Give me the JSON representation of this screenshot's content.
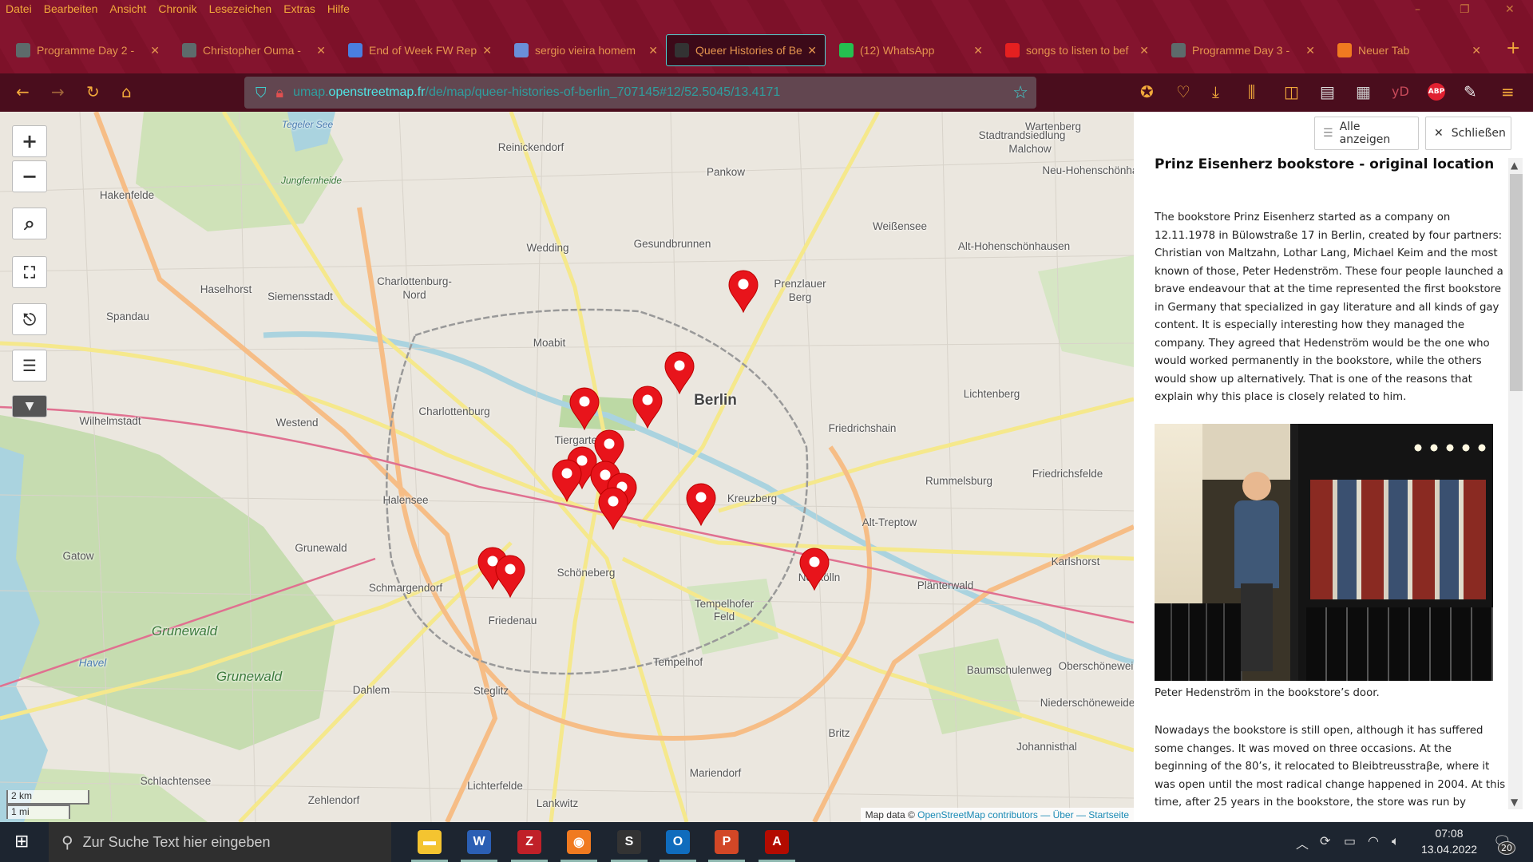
{
  "menu": [
    "Datei",
    "Bearbeiten",
    "Ansicht",
    "Chronik",
    "Lesezeichen",
    "Extras",
    "Hilfe"
  ],
  "window_controls": {
    "minimize": "–",
    "restore": "❐",
    "close": "✕"
  },
  "tabs": [
    {
      "title": "Programme Day 2 -",
      "icon": "x-logo-icon",
      "color": "#5d6b6b"
    },
    {
      "title": "Christopher Ouma -",
      "icon": "x-logo-icon",
      "color": "#5d6b6b"
    },
    {
      "title": "End of Week FW Rep",
      "icon": "google-docs-icon",
      "color": "#4a7fe0"
    },
    {
      "title": "sergio vieira homem",
      "icon": "diamond-icon",
      "color": "#6a8fd8"
    },
    {
      "title": "Queer Histories of Be",
      "icon": "umap-icon",
      "color": "#333",
      "active": true
    },
    {
      "title": "(12) WhatsApp",
      "icon": "whatsapp-icon",
      "color": "#25c050"
    },
    {
      "title": "songs to listen to bef",
      "icon": "youtube-icon",
      "color": "#e52020"
    },
    {
      "title": "Programme Day 3 -",
      "icon": "x-logo-icon",
      "color": "#5d6b6b"
    },
    {
      "title": "Neuer Tab",
      "icon": "firefox-icon",
      "color": "#f07a20"
    }
  ],
  "new_tab": "+",
  "url": {
    "sub": "umap.",
    "domain": "openstreetmap.fr",
    "path": "/de/map/queer-histories-of-berlin_707145#12/52.5045/13.4171"
  },
  "map": {
    "controls": {
      "zoom_in": "+",
      "zoom_out": "−"
    },
    "labels": [
      "Reinickendorf",
      "Wartenberg",
      "Stadtrandsiedlung",
      "Malchow",
      "Pankow",
      "Neu-Hohenschönhausen",
      "Hakenfelde",
      "Weißensee",
      "Gesundbrunnen",
      "Wedding",
      "Alt-Hohenschönhausen",
      "Haselhorst",
      "Siemensstadt",
      "Charlottenburg-",
      "Nord",
      "Spandau",
      "Prenzlauer",
      "Berg",
      "Moabit",
      "Berlin",
      "Lichtenberg",
      "Wilhelmstadt",
      "Westend",
      "Charlottenburg",
      "Tiergarten",
      "Friedrichshain",
      "Rummelsburg",
      "Friedrichsfelde",
      "Halensee",
      "Kreuzberg",
      "Alt-Treptow",
      "Grunewald",
      "Gatow",
      "Karlshorst",
      "Schmargendorf",
      "Schöneberg",
      "Neukölln",
      "Plänterwald",
      "Friedenau",
      "Tempelhofer",
      "Feld",
      "Grunewald",
      "Grunewald",
      "Tempelhof",
      "Baumschulenweg",
      "Oberschöneweide",
      "Dahlem",
      "Steglitz",
      "Niederschöneweide",
      "Britz",
      "Johannisthal",
      "Mariendorf",
      "Schlachtensee",
      "Lichterfelde",
      "Zehlendorf",
      "Lankwitz",
      "Havel",
      "Jungfernheide",
      "Tegeler See"
    ],
    "marker_count": 14,
    "scale": {
      "km": "2 km",
      "mi": "1 mi"
    },
    "attribution": {
      "prefix": "Map data ©",
      "osm": "OpenStreetMap contributors",
      "sep1": "—",
      "about": "Über",
      "sep2": "—",
      "home": "Startseite"
    }
  },
  "panel": {
    "show_all": "Alle anzeigen",
    "close": "Schließen",
    "title": "Prinz Eisenherz bookstore - original location",
    "para1": "The bookstore Prinz Eisenherz started as a company on 12.11.1978 in Bülowstraße 17 in Berlin, created by four partners: Christian von Maltzahn, Lothar Lang, Michael Keim and the most known of those, Peter Hedenström. These four people launched a brave endeavour that at the time represented the first bookstore in Germany that specialized in gay literature and all kinds of gay content. It is especially interesting how they managed the company. They agreed that Hedenström would be the one who would worked permanently in the bookstore, while the others would show up alternatively. That is one of the reasons that explain why this place is closely related to him.",
    "caption": "Peter Hedenström in the bookstore’s door.",
    "para2": "Nowadays the bookstore is still open, although it has suffered some changes. It was moved on three occasions. At the beginning of the 80’s, it relocated to Bleibtreusstraβe, where it was open until the most radical change happened in 2004. At this time, after 25 years in the bookstore, the store was run by"
  },
  "taskbar": {
    "search_placeholder": "Zur Suche Text hier eingeben",
    "time": "07:08",
    "date": "13.04.2022",
    "notifications": "20",
    "apps": [
      {
        "name": "file-explorer",
        "glyph": "▬",
        "color": "#f4c430"
      },
      {
        "name": "word",
        "glyph": "W",
        "color": "#2b5fb4"
      },
      {
        "name": "zotero",
        "glyph": "Z",
        "color": "#c02028"
      },
      {
        "name": "firefox",
        "glyph": "◉",
        "color": "#f07a20"
      },
      {
        "name": "scrivener",
        "glyph": "S",
        "color": "#333"
      },
      {
        "name": "outlook",
        "glyph": "O",
        "color": "#0f6cbd"
      },
      {
        "name": "powerpoint",
        "glyph": "P",
        "color": "#d24726"
      },
      {
        "name": "acrobat",
        "glyph": "A",
        "color": "#b30b00"
      }
    ]
  },
  "colors": {
    "chrome": "#7a1028",
    "navbar": "#4a0d1d",
    "accent": "#4fd3d3",
    "menu_text": "#f2a93b",
    "marker": "#e8141b"
  }
}
